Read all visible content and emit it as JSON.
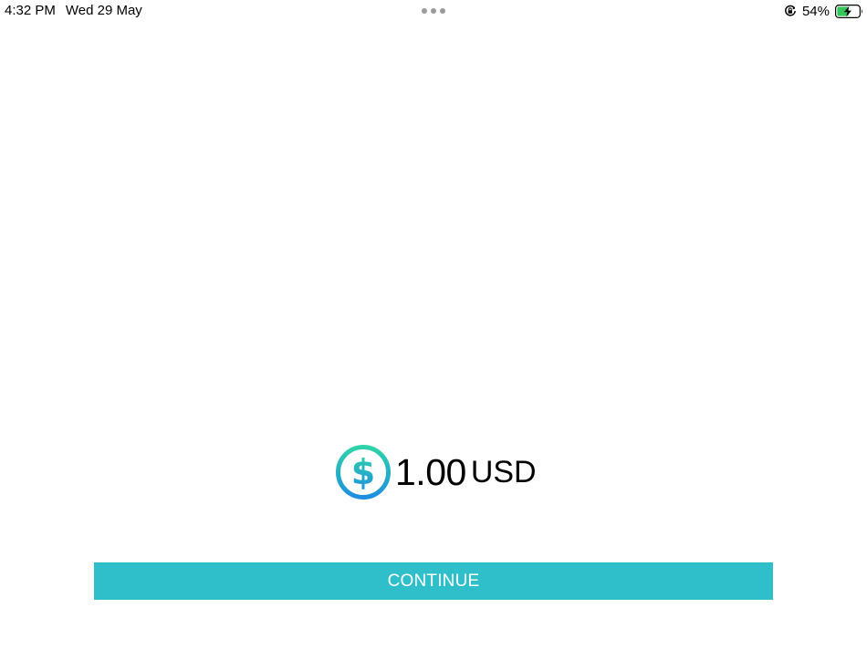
{
  "status_bar": {
    "time": "4:32 PM",
    "date": "Wed 29 May",
    "battery_percent": "54%",
    "battery_level": 0.54,
    "battery_color": "#34c759",
    "icons": [
      "multitasking-dots-icon",
      "orientation-lock-icon",
      "battery-charging-icon"
    ]
  },
  "payment": {
    "icon": "dollar-coin-icon",
    "amount": "1.00",
    "currency": "USD"
  },
  "actions": {
    "continue_label": "CONTINUE"
  },
  "colors": {
    "accent": "#2fbfca",
    "icon_gradient_start": "#2ed3a8",
    "icon_gradient_end": "#1e8fe0"
  }
}
